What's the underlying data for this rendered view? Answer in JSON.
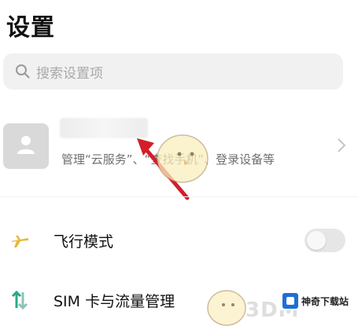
{
  "header": {
    "title": "设置"
  },
  "search": {
    "placeholder": "搜索设置项",
    "icon": "search-icon"
  },
  "account": {
    "description": "管理“云服务”、“查找手机”、登录设备等",
    "avatar_icon": "person-icon",
    "chevron_icon": "chevron-right-icon"
  },
  "settings": [
    {
      "label": "飞行模式",
      "icon": "airplane-icon",
      "toggle": "off"
    },
    {
      "label": "SIM 卡与流量管理",
      "icon": "sim-data-icon"
    }
  ],
  "watermark": {
    "site": "神奇下载站",
    "brand": "3DM"
  },
  "colors": {
    "annotation_arrow": "#d21f2a",
    "toggle_off": "#e6e6e6"
  }
}
